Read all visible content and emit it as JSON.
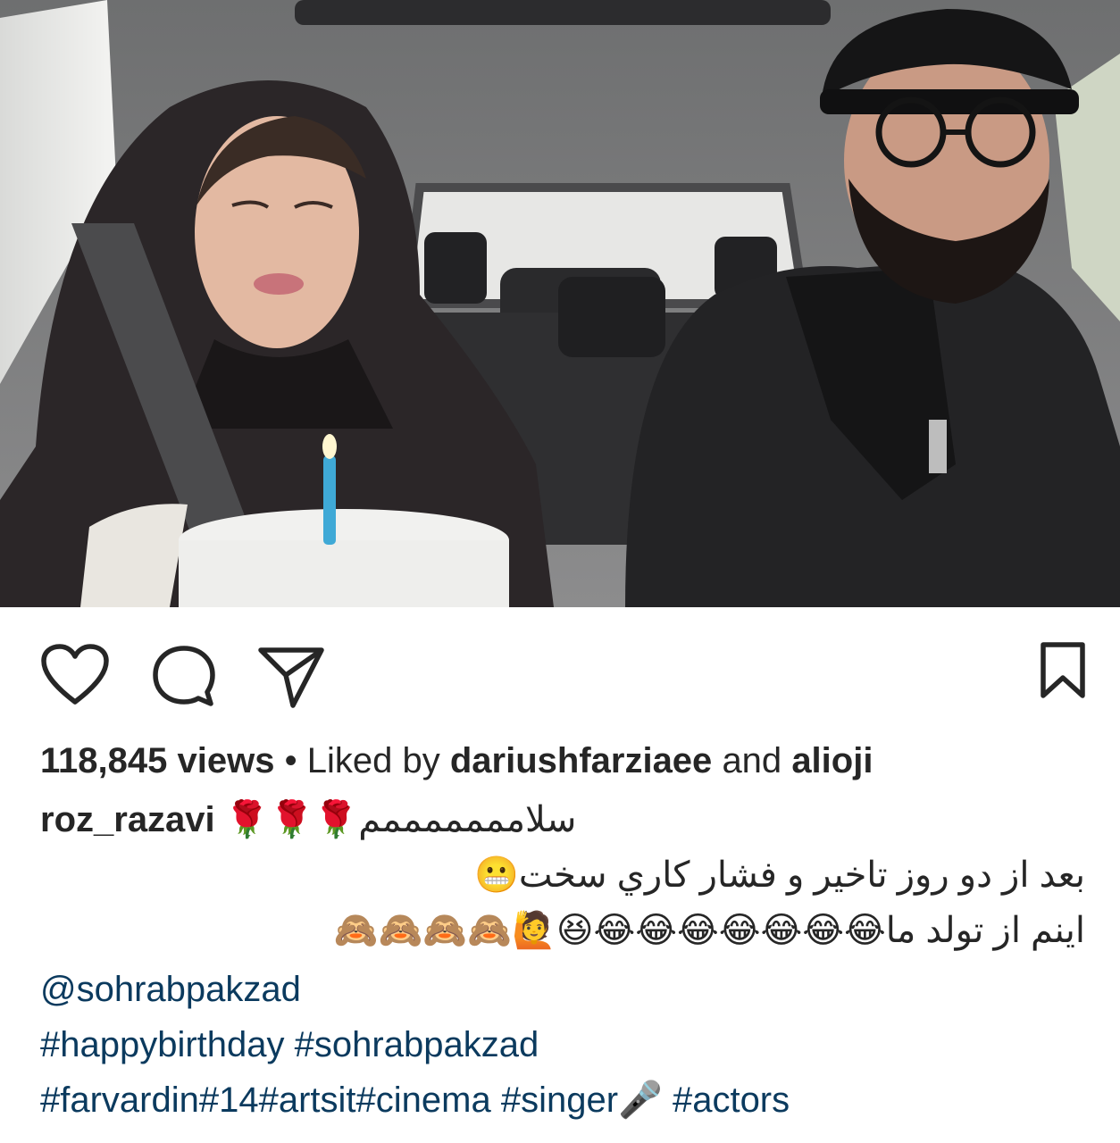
{
  "post": {
    "image_alt": "",
    "actions": {
      "like_icon": "heart-icon",
      "comment_icon": "comment-bubble-icon",
      "share_icon": "paper-plane-icon",
      "save_icon": "bookmark-icon"
    },
    "stats": {
      "views": "118,845 views",
      "separator": "•",
      "liked_by_prefix": "Liked by",
      "liker_1": "dariushfarziaee",
      "conjunction": "and",
      "liker_2": "alioji"
    },
    "caption": {
      "username": "roz_razavi",
      "line_1_text": "سلامممممممم",
      "line_1_emoji": "🌹🌹🌹",
      "line_2_text": "بعد از دو روز تاخير و فشار كاري سخت",
      "line_2_emoji": "😬",
      "line_3_text": "اینم از تولد ما",
      "line_3_emoji": "😂😂😂😂😂😂😂😆🙋🙈🙈🙈🙈",
      "mention": "@sohrabpakzad",
      "hashtags_line_1": "#happybirthday #sohrabpakzad",
      "hashtags_line_2_a": "#farvardin#14#artsit#cinema #singer",
      "hashtags_line_2_emoji": "🎤",
      "hashtags_line_2_b": " #actors"
    }
  }
}
